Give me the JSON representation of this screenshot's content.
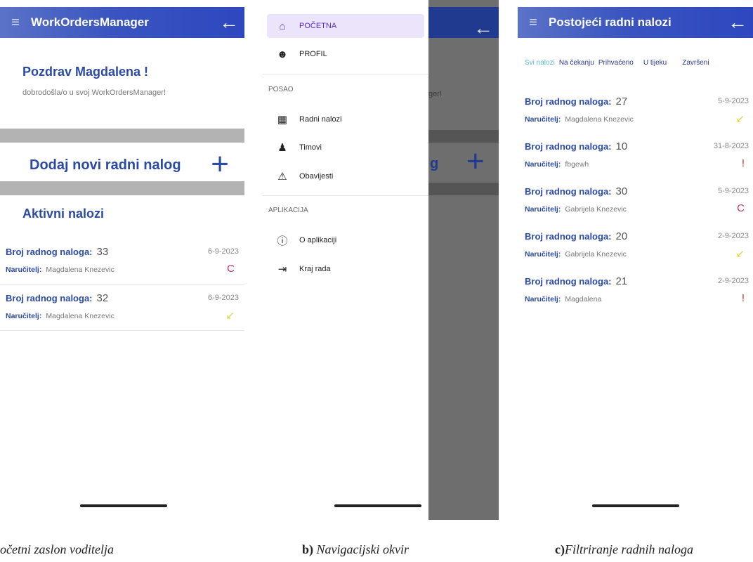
{
  "screen_a": {
    "app_title": "WorkOrdersManager",
    "greeting": "Pozdrav Magdalena !",
    "welcome": "dobrodošla/o u svoj WorkOrdersManager!",
    "add_label": "Dodaj novi radni nalog",
    "add_icon": "+",
    "section_title": "Aktivni nalozi",
    "orders": [
      {
        "number_label": "Broj radnog naloga:",
        "number": "33",
        "client_label": "Naručitelj:",
        "client": "Magdalena Knezevic",
        "date": "6-9-2023",
        "status_icon": "C",
        "status_color": "#c0396b"
      },
      {
        "number_label": "Broj radnog naloga:",
        "number": "32",
        "client_label": "Naručitelj:",
        "client": "Magdalena Knezevic",
        "date": "6-9-2023",
        "status_icon": "↙",
        "status_color": "#e2d23a"
      }
    ],
    "caption": "očetni zaslon voditelja"
  },
  "screen_b": {
    "nav_items": [
      {
        "label": "POČETNA",
        "icon": "home-icon"
      },
      {
        "label": "PROFIL",
        "icon": "account-icon"
      }
    ],
    "section_posao": "POSAO",
    "posao_items": [
      {
        "label": "Radni nalozi",
        "icon": "dashboard-icon"
      },
      {
        "label": "Timovi",
        "icon": "people-icon"
      },
      {
        "label": "Obavijesti",
        "icon": "alarm-icon"
      }
    ],
    "section_aplikacija": "APLIKACIJA",
    "aplikacija_items": [
      {
        "label": "O aplikaciji",
        "icon": "info-icon"
      },
      {
        "label": "Kraj rada",
        "icon": "logout-icon"
      }
    ],
    "bg_text": "ger!",
    "bg_g": "g",
    "bg_plus": "+",
    "caption_bold": "b)",
    "caption": " Navigacijski okvir"
  },
  "screen_c": {
    "app_title": "Postojeći radni nalozi",
    "tabs": [
      "Svi nalozi",
      "Na čekanju",
      "Prihvaćeno",
      "U tijeku",
      "Završeni"
    ],
    "orders": [
      {
        "number_label": "Broj radnog naloga:",
        "number": "27",
        "client_label": "Naručitelj:",
        "client": "Magdalena Knezevic",
        "date": "5-9-2023",
        "status_icon": "↙",
        "status_color": "#e2d23a"
      },
      {
        "number_label": "Broj radnog naloga:",
        "number": "10",
        "client_label": "Naručitelj:",
        "client": "fbgewh",
        "date": "31-8-2023",
        "status_icon": "!",
        "status_color": "#d32f2f"
      },
      {
        "number_label": "Broj radnog naloga:",
        "number": "30",
        "client_label": "Naručitelj:",
        "client": "Gabrijela Knezevic",
        "date": "5-9-2023",
        "status_icon": "C",
        "status_color": "#c0396b"
      },
      {
        "number_label": "Broj radnog naloga:",
        "number": "20",
        "client_label": "Naručitelj:",
        "client": "Gabrijela Knezevic",
        "date": "2-9-2023",
        "status_icon": "↙",
        "status_color": "#e2d23a"
      },
      {
        "number_label": "Broj radnog naloga:",
        "number": "21",
        "client_label": "Naručitelj:",
        "client": "Magdalena",
        "date": "2-9-2023",
        "status_icon": "!",
        "status_color": "#d32f2f"
      }
    ],
    "caption_bold": "c)",
    "caption": "Filtriranje radnih naloga"
  }
}
